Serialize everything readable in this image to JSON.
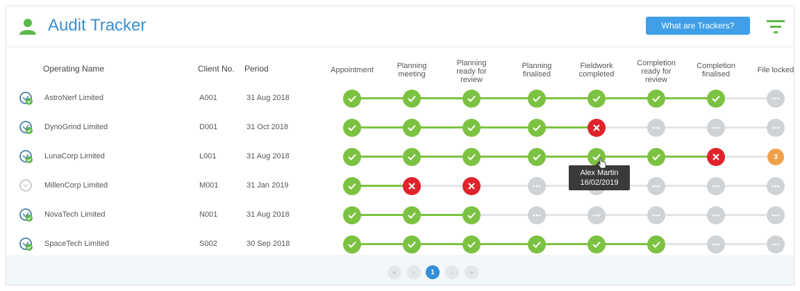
{
  "header": {
    "title": "Audit Tracker",
    "trackers_button": "What are Trackers?",
    "app_icon": "user-icon",
    "filter_icon": "filter-icon"
  },
  "columns": {
    "operating_name": "Operating Name",
    "client_no": "Client No.",
    "period": "Period",
    "stages": [
      [
        "Appointment"
      ],
      [
        "Planning",
        "meeting"
      ],
      [
        "Planning",
        "ready for",
        "review"
      ],
      [
        "Planning",
        "finalised"
      ],
      [
        "Fieldwork",
        "completed"
      ],
      [
        "Completion",
        "ready for",
        "review"
      ],
      [
        "Completion",
        "finalised"
      ],
      [
        "File locked"
      ]
    ]
  },
  "rows": [
    {
      "name": "AstroNerf Limited",
      "client": "A001",
      "period": "31 Aug 2018",
      "icon": "progress-icon",
      "stages": [
        "done",
        "done",
        "done",
        "done",
        "done",
        "done",
        "done",
        "pending"
      ]
    },
    {
      "name": "DynoGrind Limited",
      "client": "D001",
      "period": "31 Oct 2018",
      "icon": "progress-icon",
      "stages": [
        "done",
        "done",
        "done",
        "done",
        "fail",
        "pending",
        "pending",
        "pending"
      ]
    },
    {
      "name": "LunaCorp Limited",
      "client": "L001",
      "period": "31 Aug 2018",
      "icon": "progress-icon",
      "stages": [
        "done",
        "done",
        "done",
        "done",
        "done",
        "done",
        "fail",
        "count:3"
      ]
    },
    {
      "name": "MillenCorp Limited",
      "client": "M001",
      "period": "31 Jan 2019",
      "icon": "empty-progress-icon",
      "stages": [
        "done",
        "fail",
        "fail",
        "pending",
        "pending",
        "pending",
        "pending",
        "pending"
      ]
    },
    {
      "name": "NovaTech Limited",
      "client": "N001",
      "period": "31 Aug 2018",
      "icon": "progress-icon",
      "stages": [
        "done",
        "done",
        "done",
        "pending",
        "pending",
        "pending",
        "pending",
        "pending"
      ]
    },
    {
      "name": "SpaceTech Limited",
      "client": "S002",
      "period": "30 Sep 2018",
      "icon": "progress-icon",
      "stages": [
        "done",
        "done",
        "done",
        "done",
        "done",
        "done",
        "pending",
        "pending"
      ]
    }
  ],
  "tooltip": {
    "name": "Alex Martin",
    "date": "16/02/2019"
  },
  "pagination": {
    "first": "«",
    "prev": "‹",
    "current": "1",
    "next": "›",
    "last": "»"
  },
  "colors": {
    "accent": "#3a8fd0",
    "done": "#7cc242",
    "fail": "#e0232b",
    "pending": "#cfd3d6",
    "count": "#f0a04b",
    "button": "#3f9fe8"
  }
}
